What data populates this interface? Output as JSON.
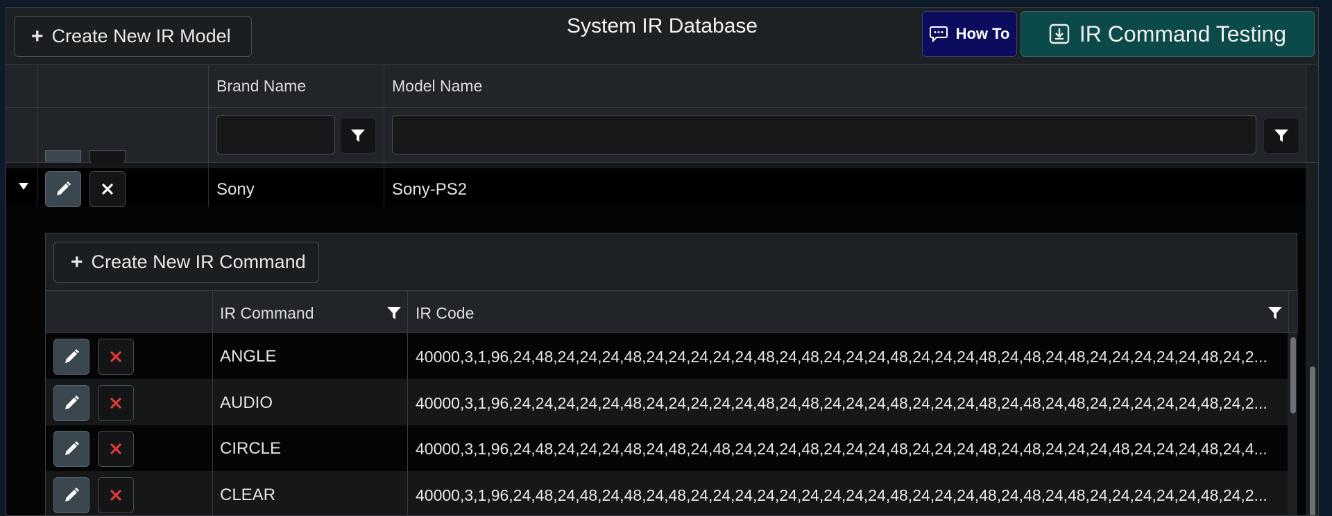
{
  "header": {
    "create_model_label": "Create New IR Model",
    "title": "System IR Database",
    "howto_label": "How To",
    "ir_testing_label": "IR Command Testing"
  },
  "grid": {
    "columns": [
      "Brand Name",
      "Model Name"
    ],
    "expanded_row": {
      "brand": "Sony",
      "model": "Sony-PS2"
    }
  },
  "detail": {
    "create_command_label": "Create New IR Command",
    "columns": [
      "IR Command",
      "IR Code"
    ],
    "rows": [
      {
        "command": "ANGLE",
        "code": "40000,3,1,96,24,48,24,24,24,48,24,24,24,24,24,48,24,48,24,24,24,48,24,24,24,48,24,48,24,48,24,24,24,24,24,48,24,2..."
      },
      {
        "command": "AUDIO",
        "code": "40000,3,1,96,24,24,24,24,24,48,24,24,24,24,24,48,24,48,24,24,24,48,24,24,24,48,24,48,24,48,24,24,24,24,24,48,24,2..."
      },
      {
        "command": "CIRCLE",
        "code": "40000,3,1,96,24,48,24,24,24,48,24,48,24,48,24,24,24,48,24,24,24,48,24,24,24,48,24,48,24,24,24,48,24,24,24,48,24,4..."
      },
      {
        "command": "CLEAR",
        "code": "40000,3,1,96,24,48,24,48,24,48,24,48,24,24,24,24,24,24,24,24,24,48,24,24,24,48,24,48,24,48,24,24,24,24,24,48,24,2..."
      }
    ]
  },
  "colors": {
    "panel_bg": "#1e2124",
    "howto_bg": "#0c0c5e",
    "ir_testing_bg": "#0b4a49",
    "delete_red": "#e53935"
  },
  "icons": [
    "plus-icon",
    "chat-icon",
    "download-icon",
    "filter-icon",
    "caret-down-icon",
    "pencil-icon",
    "close-icon"
  ]
}
